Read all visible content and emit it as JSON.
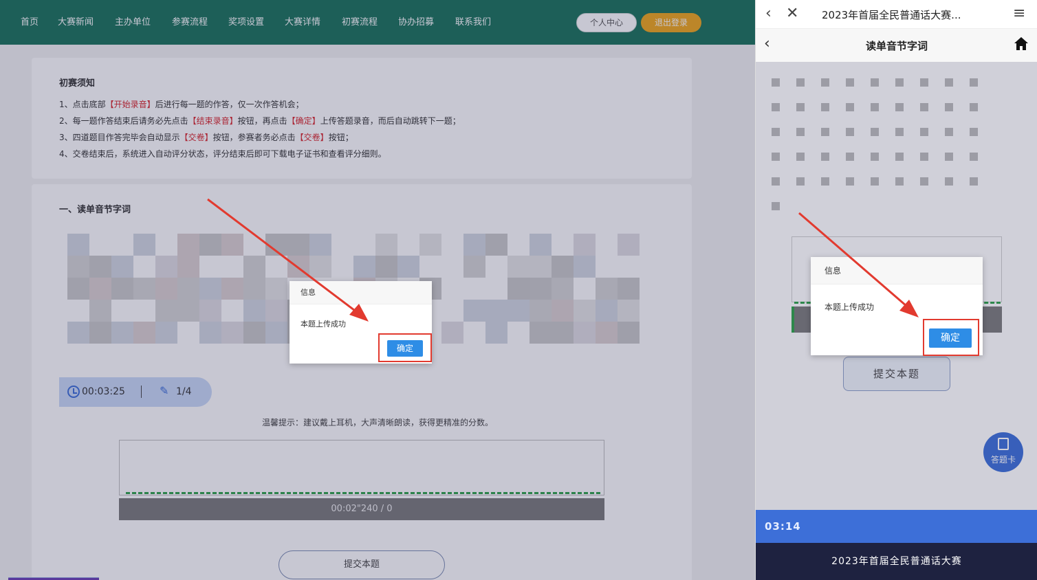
{
  "desktop": {
    "nav": [
      "首页",
      "大赛新闻",
      "主办单位",
      "参赛流程",
      "奖项设置",
      "大赛详情",
      "初赛流程",
      "协办招募",
      "联系我们"
    ],
    "personal_center": "个人中心",
    "logout": "退出登录",
    "notice": {
      "title": "初赛须知",
      "line1_a": "1、点击底部",
      "line1_b": "【开始录音】",
      "line1_c": "后进行每一题的作答，仅一次作答机会；",
      "line2_a": "2、每一题作答结束后请务必先点击",
      "line2_b": "【结束录音】",
      "line2_c": "按钮，再点击",
      "line2_d": "【确定】",
      "line2_e": "上传答题录音，而后自动跳转下一题；",
      "line3_a": "3、四道题目作答完毕会自动显示",
      "line3_b": "【交卷】",
      "line3_c": "按钮，参赛者务必点击",
      "line3_d": "【交卷】",
      "line3_e": "按钮；",
      "line4": "4、交卷结束后，系统进入自动评分状态，评分结束后即可下载电子证书和查看评分细则。"
    },
    "section_title": "一、读单音节字词",
    "timer": "00:03:25",
    "progress": "1/4",
    "tip": "温馨提示：建议戴上耳机，大声清晰朗读，获得更精准的分数。",
    "recording_time": "00:02\"240 / 0",
    "submit": "提交本题",
    "dialog": {
      "title": "信息",
      "message": "本题上传成功",
      "ok": "确定"
    }
  },
  "mobile": {
    "title": "2023年首届全民普通话大赛...",
    "subtitle": "读单音节字词",
    "submit": "提交本题",
    "answer_card": "答题卡",
    "time": "03:14",
    "footer": "2023年首届全民普通话大赛",
    "dialog": {
      "title": "信息",
      "message": "本题上传成功",
      "ok": "确定"
    }
  },
  "colors": {
    "nav_green": "#1a735b",
    "logout_orange": "#f0a81c",
    "accent_blue": "#2e8de6",
    "highlight_red": "#e23a2f"
  }
}
